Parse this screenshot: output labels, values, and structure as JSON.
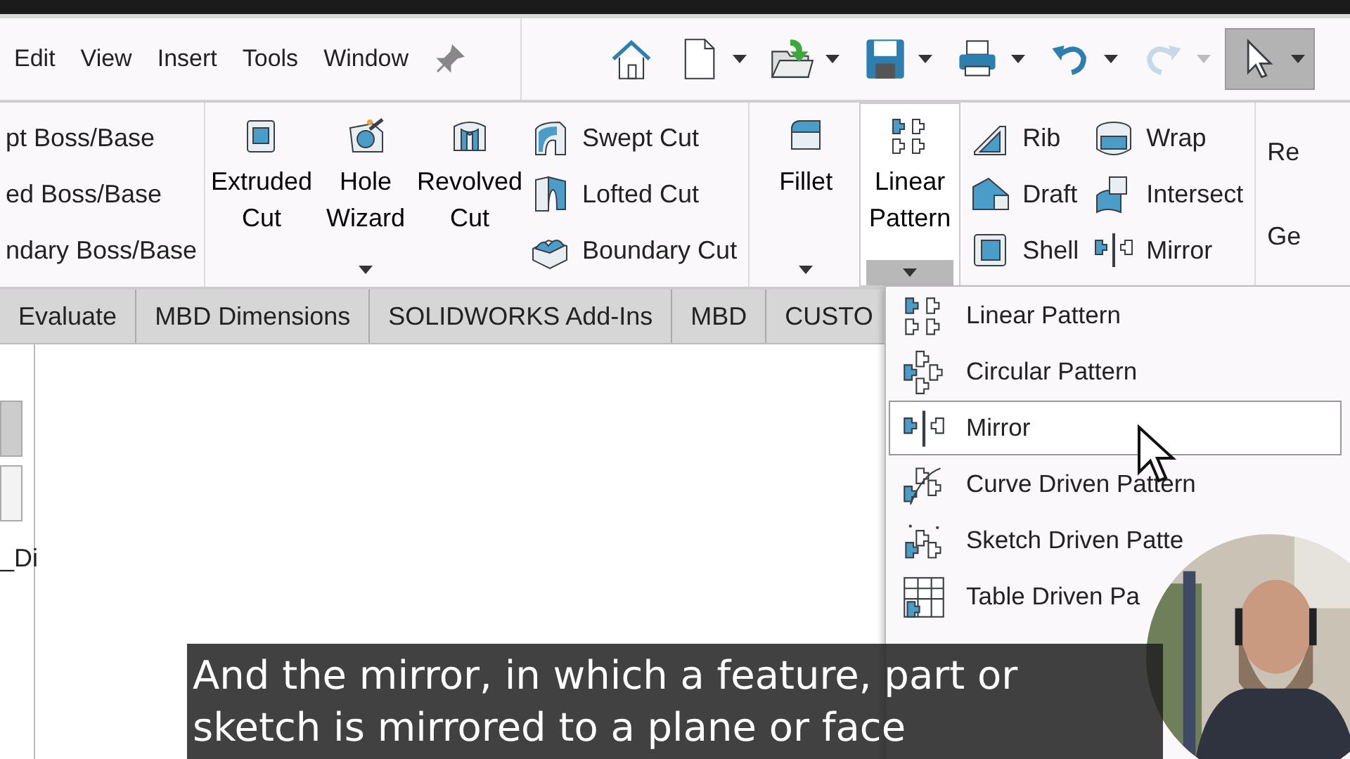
{
  "menu": [
    {
      "label": "Edit"
    },
    {
      "label": "View"
    },
    {
      "label": "Insert"
    },
    {
      "label": "Tools"
    },
    {
      "label": "Window"
    }
  ],
  "toolbar": [
    {
      "kind": "home",
      "dropdown": false,
      "disabled": false,
      "selected": false
    },
    {
      "kind": "new",
      "dropdown": true,
      "disabled": false,
      "selected": false
    },
    {
      "kind": "open",
      "dropdown": true,
      "disabled": false,
      "selected": false
    },
    {
      "kind": "save",
      "dropdown": true,
      "disabled": false,
      "selected": false
    },
    {
      "kind": "print",
      "dropdown": true,
      "disabled": false,
      "selected": false
    },
    {
      "kind": "undo",
      "dropdown": true,
      "disabled": false,
      "selected": false
    },
    {
      "kind": "redo",
      "dropdown": true,
      "disabled": true,
      "selected": false
    },
    {
      "kind": "select",
      "dropdown": true,
      "disabled": false,
      "selected": true
    }
  ],
  "ribbon": [
    [
      {
        "kind": "list",
        "items": [
          {
            "label": "pt Boss/Base"
          },
          {
            "label": "ed Boss/Base"
          },
          {
            "label": "ndary Boss/Base"
          }
        ]
      }
    ],
    [
      {
        "kind": "large",
        "label": "Extruded Cut",
        "dropdown": false,
        "expanded": false
      },
      {
        "kind": "large",
        "label": "Hole Wizard",
        "dropdown": true,
        "expanded": false
      },
      {
        "kind": "large",
        "label": "Revolved Cut",
        "dropdown": false,
        "expanded": false
      },
      {
        "kind": "list",
        "items": [
          {
            "label": "Swept Cut"
          },
          {
            "label": "Lofted Cut"
          },
          {
            "label": "Boundary Cut"
          }
        ]
      }
    ],
    [
      {
        "kind": "large",
        "label": "Fillet",
        "dropdown": true,
        "expanded": false
      },
      {
        "kind": "large",
        "label": "Linear Pattern",
        "dropdown": true,
        "expanded": true
      },
      {
        "kind": "list",
        "items": [
          {
            "label": "Rib"
          },
          {
            "label": "Draft"
          },
          {
            "label": "Shell"
          }
        ]
      },
      {
        "kind": "list",
        "items": [
          {
            "label": "Wrap"
          },
          {
            "label": "Intersect"
          },
          {
            "label": "Mirror"
          }
        ]
      }
    ],
    [
      {
        "kind": "list",
        "items": [
          {
            "label": "Re"
          },
          {
            "label": "Ge"
          }
        ]
      }
    ]
  ],
  "tabs": [
    {
      "label": "Evaluate",
      "selected": false
    },
    {
      "label": "MBD Dimensions",
      "selected": false
    },
    {
      "label": "SOLIDWORKS Add-Ins",
      "selected": false
    },
    {
      "label": "MBD",
      "selected": false
    },
    {
      "label": "CUSTO",
      "selected": false
    }
  ],
  "tree_panel": {
    "label": "_Di"
  },
  "dropdown": [
    {
      "label": "Linear Pattern",
      "selected": false
    },
    {
      "label": "Circular Pattern",
      "selected": false
    },
    {
      "label": "Mirror",
      "selected": true
    },
    {
      "label": "Curve Driven Pattern",
      "selected": false
    },
    {
      "label": "Sketch Driven Patte",
      "selected": false
    },
    {
      "label": "Table Driven Pa",
      "selected": false
    }
  ],
  "webcam": {
    "kind": "picture"
  },
  "caption": "And the mirror, in which a feature, part or sketch is mirrored to a plane or face"
}
